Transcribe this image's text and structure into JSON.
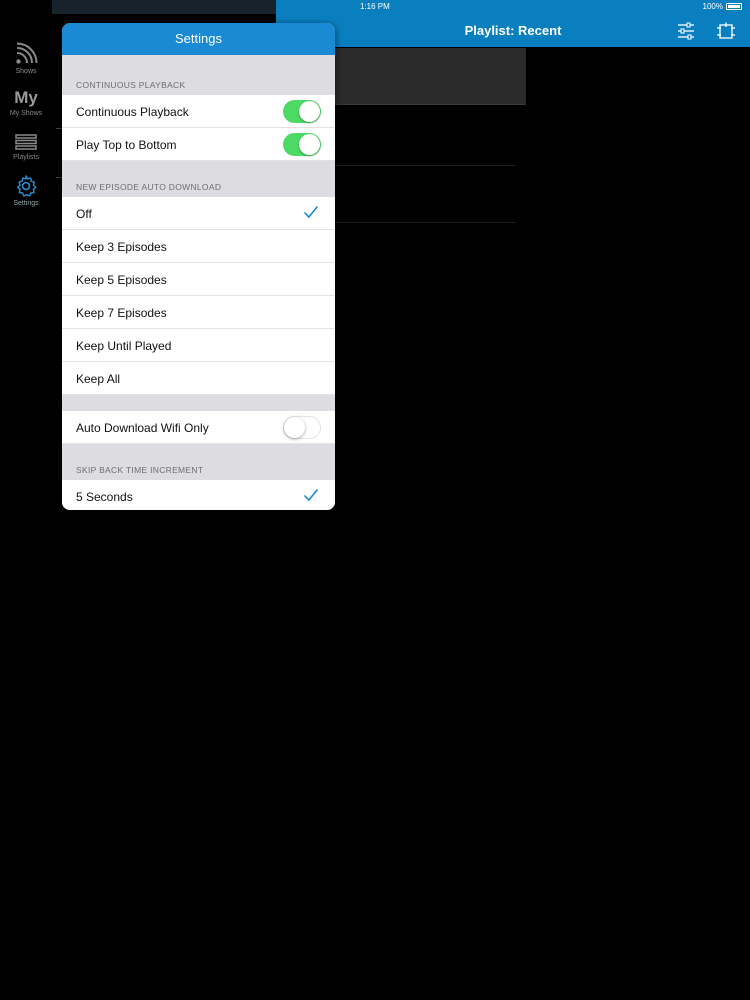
{
  "status_bar": {
    "time": "1:16 PM",
    "battery": "100%"
  },
  "navbar": {
    "title": "Playlist: Recent",
    "left_icon": "list-settings-icon",
    "right_icon": "edit-icon"
  },
  "sidebar": {
    "items": [
      {
        "label": "Shows",
        "icon": "rss-icon"
      },
      {
        "label": "My Shows",
        "icon_text": "My"
      },
      {
        "label": "Playlists",
        "icon": "stack-icon"
      },
      {
        "label": "Settings",
        "icon": "gear-icon",
        "active": true
      }
    ]
  },
  "settings": {
    "title": "Settings",
    "sections": {
      "continuous": {
        "header": "CONTINUOUS PLAYBACK",
        "rows": [
          {
            "label": "Continuous Playback",
            "toggle": true
          },
          {
            "label": "Play Top to Bottom",
            "toggle": true
          }
        ]
      },
      "auto_download": {
        "header": "NEW EPISODE AUTO DOWNLOAD",
        "rows": [
          {
            "label": "Off",
            "checked": true
          },
          {
            "label": "Keep 3 Episodes",
            "checked": false
          },
          {
            "label": "Keep 5 Episodes",
            "checked": false
          },
          {
            "label": "Keep 7 Episodes",
            "checked": false
          },
          {
            "label": "Keep Until Played",
            "checked": false
          },
          {
            "label": "Keep All",
            "checked": false
          }
        ]
      },
      "wifi": {
        "rows": [
          {
            "label": "Auto Download Wifi Only",
            "toggle": false
          }
        ]
      },
      "skip_back": {
        "header": "SKIP BACK TIME INCREMENT",
        "rows": [
          {
            "label": "5 Seconds",
            "checked": true
          }
        ]
      }
    }
  },
  "colors": {
    "accent_blue": "#0a7fc0",
    "popover_header": "#1a8ad4",
    "toggle_on": "#4cd964",
    "checkmark": "#1a8ad4"
  }
}
